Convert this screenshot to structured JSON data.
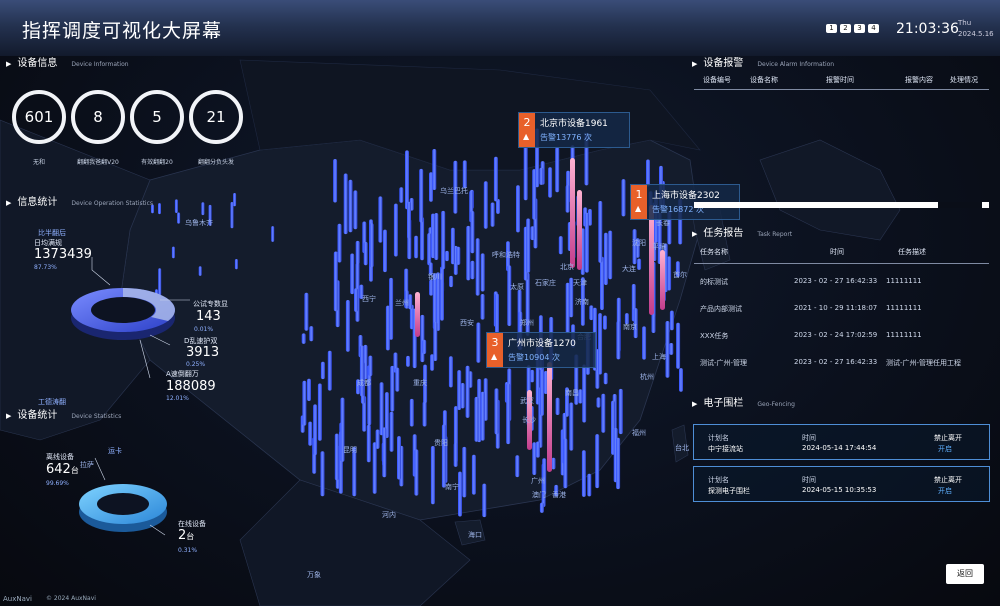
{
  "header": {
    "title": "指挥调度可视化大屏幕",
    "screens": [
      "1",
      "2",
      "3",
      "4"
    ],
    "clock": "21:03:36",
    "weekday": "Thu",
    "date": "2024.5.16"
  },
  "device_info": {
    "title": "设备信息",
    "subtitle": "Device Information",
    "circles": [
      {
        "value": "601",
        "label": "无和"
      },
      {
        "value": "8",
        "label": "翻翻我爸翻V20"
      },
      {
        "value": "5",
        "label": "有效翻翻20"
      },
      {
        "value": "21",
        "label": "翻翻分负头发"
      }
    ]
  },
  "info_stats": {
    "title": "信息统计",
    "subtitle": "Device Operation Statistics",
    "ring_percent_main": 87.73,
    "items": [
      {
        "tag": "比半翻后",
        "title": "日均满规",
        "value": "1373439",
        "percent": "87.73%"
      },
      {
        "tag": "",
        "title": "公试专数显",
        "value": "143",
        "percent": "0.01%"
      },
      {
        "tag": "",
        "title": "D乱速护双",
        "value": "3913",
        "percent": "0.25%"
      },
      {
        "tag": "",
        "title": "A速倒翻万",
        "value": "188089",
        "percent": "12.01%"
      },
      {
        "tag": "工德涛翻",
        "title": "",
        "value": "",
        "percent": ""
      }
    ]
  },
  "device_stats": {
    "title": "设备统计",
    "subtitle": "Device Statistics",
    "ring_percent_main": 99.69,
    "items": [
      {
        "tag": "运卡",
        "title": "离线设备",
        "value": "642",
        "unit": "台",
        "percent": "99.69%"
      },
      {
        "tag": "",
        "title": "在线设备",
        "value": "2",
        "unit": "台",
        "percent": "0.31%"
      }
    ]
  },
  "map": {
    "cities": [
      "乌鲁木齐",
      "乌兰巴托",
      "呼和浩特",
      "北京",
      "天津",
      "太原",
      "石家庄",
      "济南",
      "银川",
      "兰州",
      "西宁",
      "西安",
      "郑州",
      "合肥",
      "南京",
      "上海",
      "杭州",
      "武汉",
      "长沙",
      "南昌",
      "福州",
      "重庆",
      "成都",
      "贵阳",
      "昆明",
      "南宁",
      "广州",
      "香港",
      "澳门",
      "海口",
      "台北",
      "拉萨",
      "河内",
      "万象",
      "沈阳",
      "长春",
      "首尔",
      "平壤",
      "大连"
    ],
    "callouts": [
      {
        "rank": "2",
        "name": "北京市设备1961",
        "count": "告警13776 次"
      },
      {
        "rank": "1",
        "name": "上海市设备2302",
        "count": "告警16872 次"
      },
      {
        "rank": "3",
        "name": "广州市设备1270",
        "count": "告警10904 次"
      }
    ]
  },
  "alarm": {
    "title": "设备报警",
    "subtitle": "Device Alarm Information",
    "headers": [
      "设备编号",
      "设备名称",
      "报警时间",
      "报警内容",
      "处理情况"
    ]
  },
  "tasks": {
    "title": "任务报告",
    "subtitle": "Task Report",
    "headers": [
      "任务名称",
      "时间",
      "任务描述"
    ],
    "rows": [
      {
        "name": "的标测试",
        "time": "2023 - 02 - 27 16:42:33",
        "desc": "11111111"
      },
      {
        "name": "产品内部测试",
        "time": "2021 - 10 - 29 11:18:07",
        "desc": "11111111"
      },
      {
        "name": "XXX任务",
        "time": "2023 - 02 - 24 17:02:59",
        "desc": "11111111"
      },
      {
        "name": "测试-广州-管理",
        "time": "2023 - 02 - 27 16:42:33",
        "desc": "测试-广州-管理任用工程"
      }
    ]
  },
  "fence": {
    "title": "电子围栏",
    "subtitle": "Geo-Fencing",
    "cards": [
      {
        "plan_label": "计划名",
        "plan": "中宁接流站",
        "time_label": "时间",
        "time": "2024-05-14 17:44:54",
        "status_label": "禁止离开",
        "status": "开启"
      },
      {
        "plan_label": "计划名",
        "plan": "探测电子围栏",
        "time_label": "时间",
        "time": "2024-05-15 10:35:53",
        "status_label": "禁止离开",
        "status": "开启"
      }
    ]
  },
  "footer": {
    "logo": "AuxNavi",
    "copyright": "© 2024 AuxNavi",
    "back_button": "返回"
  },
  "colors": {
    "accent": "#3a5bff",
    "callout_badge": "#e8602a",
    "highlight_bar": "#f06ea8"
  }
}
